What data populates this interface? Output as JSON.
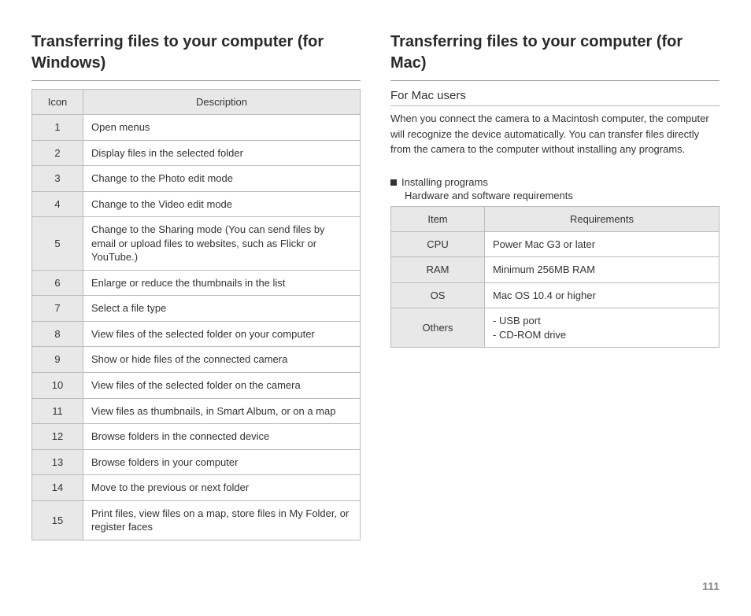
{
  "left": {
    "title": "Transferring files to your computer (for Windows)",
    "table": {
      "headers": {
        "icon": "Icon",
        "desc": "Description"
      },
      "rows": [
        {
          "n": "1",
          "d": "Open menus"
        },
        {
          "n": "2",
          "d": "Display files in the selected folder"
        },
        {
          "n": "3",
          "d": "Change to the Photo edit mode"
        },
        {
          "n": "4",
          "d": "Change to the Video edit mode"
        },
        {
          "n": "5",
          "d": "Change to the Sharing mode (You can send files by email or upload files to websites, such as Flickr or YouTube.)"
        },
        {
          "n": "6",
          "d": "Enlarge or reduce the thumbnails in the list"
        },
        {
          "n": "7",
          "d": "Select a file type"
        },
        {
          "n": "8",
          "d": "View files of the selected folder on your computer"
        },
        {
          "n": "9",
          "d": "Show or hide files of the connected camera"
        },
        {
          "n": "10",
          "d": "View files of the selected folder on the camera"
        },
        {
          "n": "11",
          "d": "View files as thumbnails, in Smart Album, or on a map"
        },
        {
          "n": "12",
          "d": "Browse folders in the connected device"
        },
        {
          "n": "13",
          "d": "Browse folders in your computer"
        },
        {
          "n": "14",
          "d": "Move to the previous or next folder"
        },
        {
          "n": "15",
          "d": "Print files, view files on a map, store files in My Folder, or register faces"
        }
      ]
    }
  },
  "right": {
    "title": "Transferring files to your computer (for Mac)",
    "subhead": "For Mac users",
    "body": "When you connect the camera to a Macintosh computer, the computer will recognize the device automatically. You can transfer files directly from the camera to the computer without installing any programs.",
    "install": {
      "line1": "Installing programs",
      "line2": "Hardware and software requirements",
      "table": {
        "headers": {
          "item": "Item",
          "req": "Requirements"
        },
        "rows": [
          {
            "item": "CPU",
            "req": "Power Mac G3 or later"
          },
          {
            "item": "RAM",
            "req": "Minimum 256MB RAM"
          },
          {
            "item": "OS",
            "req": "Mac OS 10.4 or higher"
          },
          {
            "item": "Others",
            "req": "- USB port\n- CD-ROM drive"
          }
        ]
      }
    }
  },
  "page_number": "111"
}
